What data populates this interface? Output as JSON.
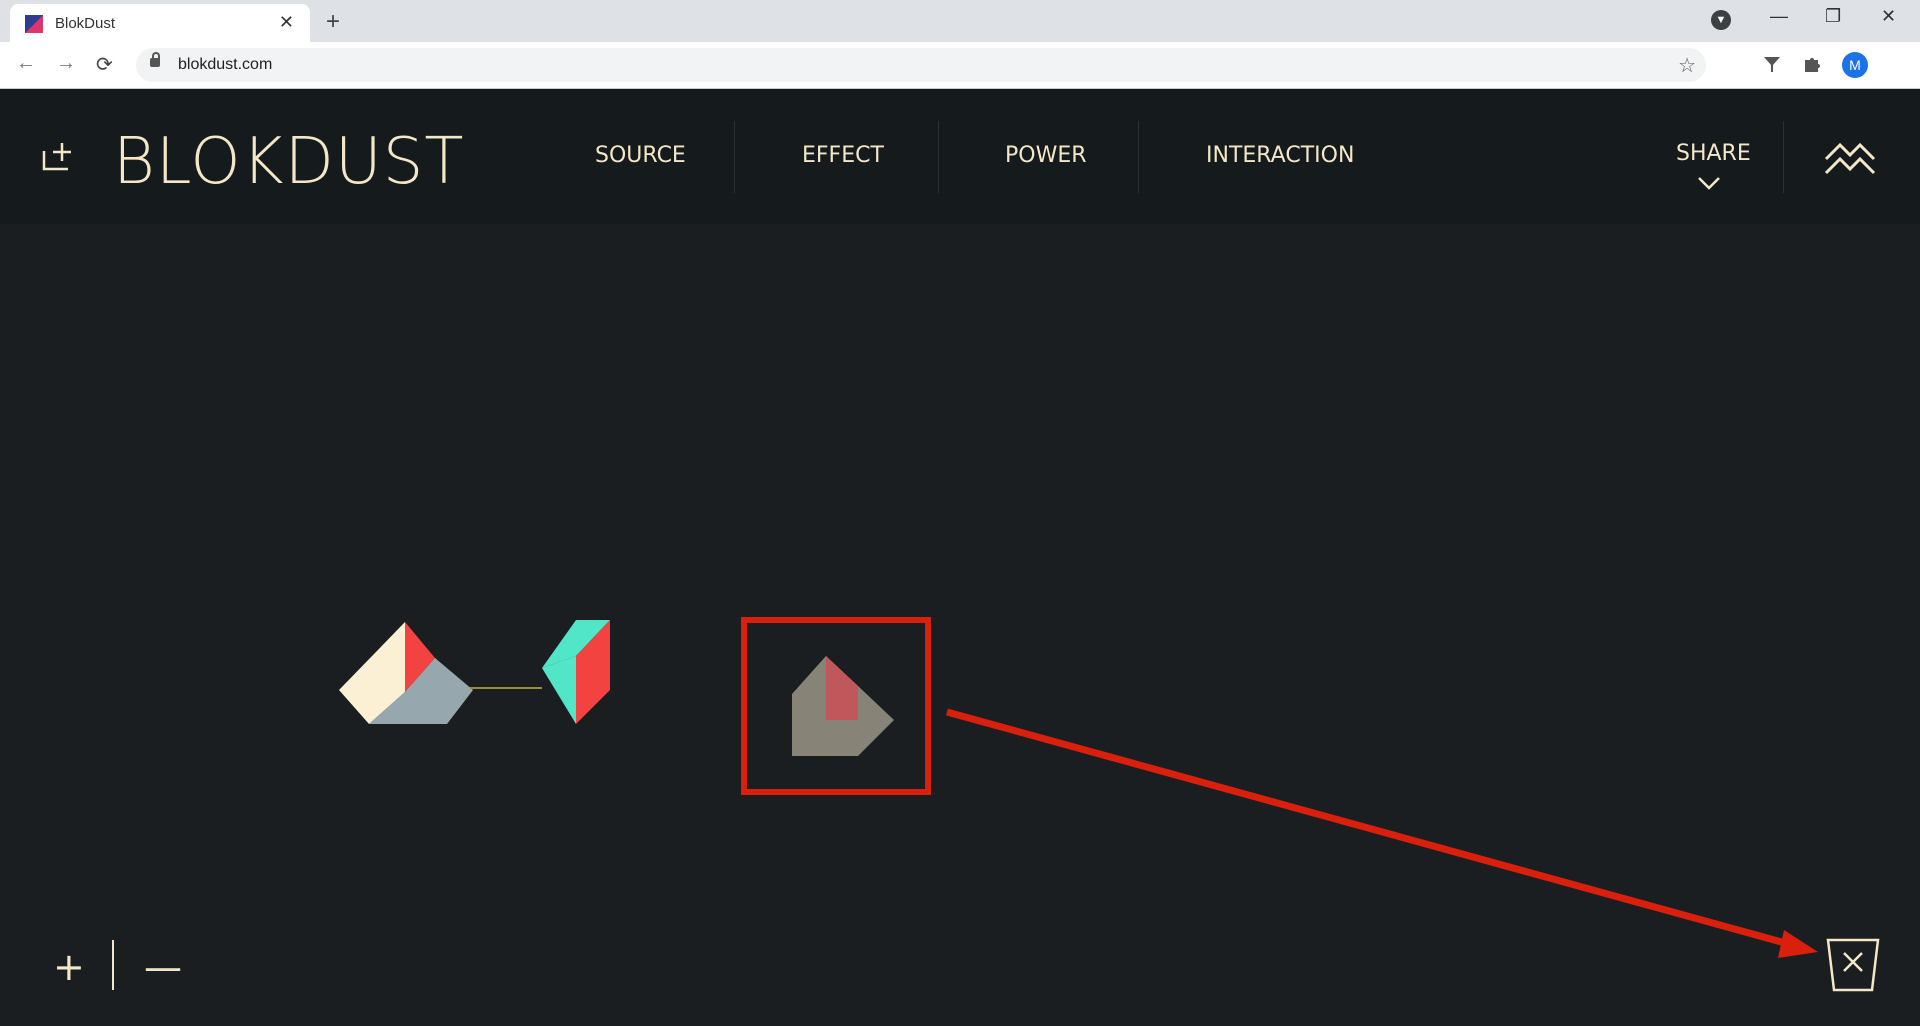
{
  "browser": {
    "tab_title": "BlokDust",
    "url": "blokdust.com",
    "profile_initial": "M",
    "tab_close_glyph": "✕",
    "new_tab_glyph": "+",
    "minimize_glyph": "—",
    "restore_glyph": "❐",
    "close_glyph": "✕",
    "back_glyph": "←",
    "forward_glyph": "→",
    "reload_glyph": "⟳",
    "star_glyph": "☆",
    "kebab_glyph": "⋮",
    "tab_search_glyph": "▼"
  },
  "app": {
    "logo": "BLOKDUST",
    "menu": [
      "SOURCE",
      "EFFECT",
      "POWER",
      "INTERACTION"
    ],
    "share_label": "SHARE",
    "zoom_in": "+",
    "zoom_out": "—"
  },
  "colors": {
    "bg": "#1b1e20",
    "header": "#151a1c",
    "cream": "#f3e7c8",
    "red": "#f24341",
    "teal": "#52e6c9",
    "grey_blue": "#96a8ad",
    "khaki": "#878477",
    "annotation": "#d8200c"
  },
  "icons": [
    "add-blok-icon",
    "share-chevron-icon",
    "wave-settings-icon",
    "trash-icon",
    "lock-icon",
    "star-icon",
    "extensions-icon",
    "puzzle-icon"
  ]
}
